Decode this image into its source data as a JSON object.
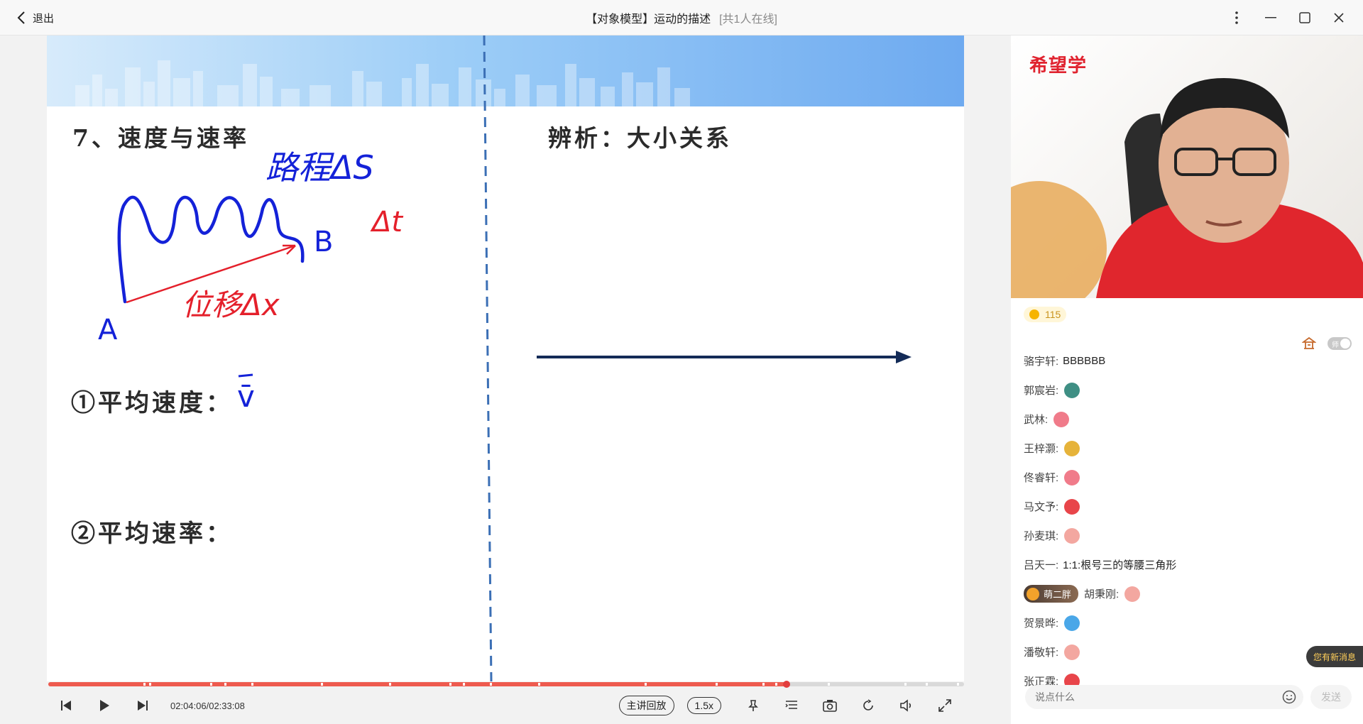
{
  "titlebar": {
    "back_label": "退出",
    "title": "【对象模型】运动的描述",
    "online": "[共1人在线]"
  },
  "slide": {
    "heading": "7、速度与速率",
    "right_heading": "辨析：大小关系",
    "item1": "①平均速度：",
    "item2": "②平均速率：",
    "hand_path": "路程ΔS",
    "hand_displacement": "位移Δx",
    "hand_time": "Δt",
    "hand_a": "A",
    "hand_b": "B",
    "hand_v": "v̄"
  },
  "player": {
    "time": "02:04:06/02:33:08",
    "replay_label": "主讲回放",
    "speed_label": "1.5x",
    "progress": 0.806
  },
  "panel": {
    "brand": "希望学",
    "coins": "115",
    "teacher_toggle": "师",
    "new_message": "您有新消息",
    "input_placeholder": "说点什么",
    "send_label": "发送"
  },
  "chat": [
    {
      "name": "骆宇轩:",
      "text": "BBBBBB"
    },
    {
      "name": "郭宸岩:",
      "emoji": "ninja-emoji",
      "color": "#3f8f84"
    },
    {
      "name": "武林:",
      "emoji": "rocket-emoji",
      "color": "#f07b8a"
    },
    {
      "name": "王梓灏:",
      "emoji": "finger-emoji",
      "color": "#e6b33a"
    },
    {
      "name": "佟睿轩:",
      "emoji": "rocket-emoji",
      "color": "#f07b8a"
    },
    {
      "name": "马文予:",
      "emoji": "lips-emoji",
      "color": "#e8454a"
    },
    {
      "name": "孙麦琪:",
      "emoji": "thumb-emoji",
      "color": "#f3a7a0"
    },
    {
      "name": "吕天一:",
      "text": "1:1:根号三的等腰三角形"
    },
    {
      "badge": "萌二胖",
      "name": "胡秉刚:",
      "emoji": "thumb-emoji",
      "color": "#f3a7a0"
    },
    {
      "name": "贺景晔:",
      "emoji": "number-emoji",
      "color": "#4aa7e8"
    },
    {
      "name": "潘敬轩:",
      "emoji": "thumb-emoji",
      "color": "#f3a7a0"
    },
    {
      "name": "张正霖:",
      "emoji": "lips-emoji",
      "color": "#e8454a"
    }
  ]
}
